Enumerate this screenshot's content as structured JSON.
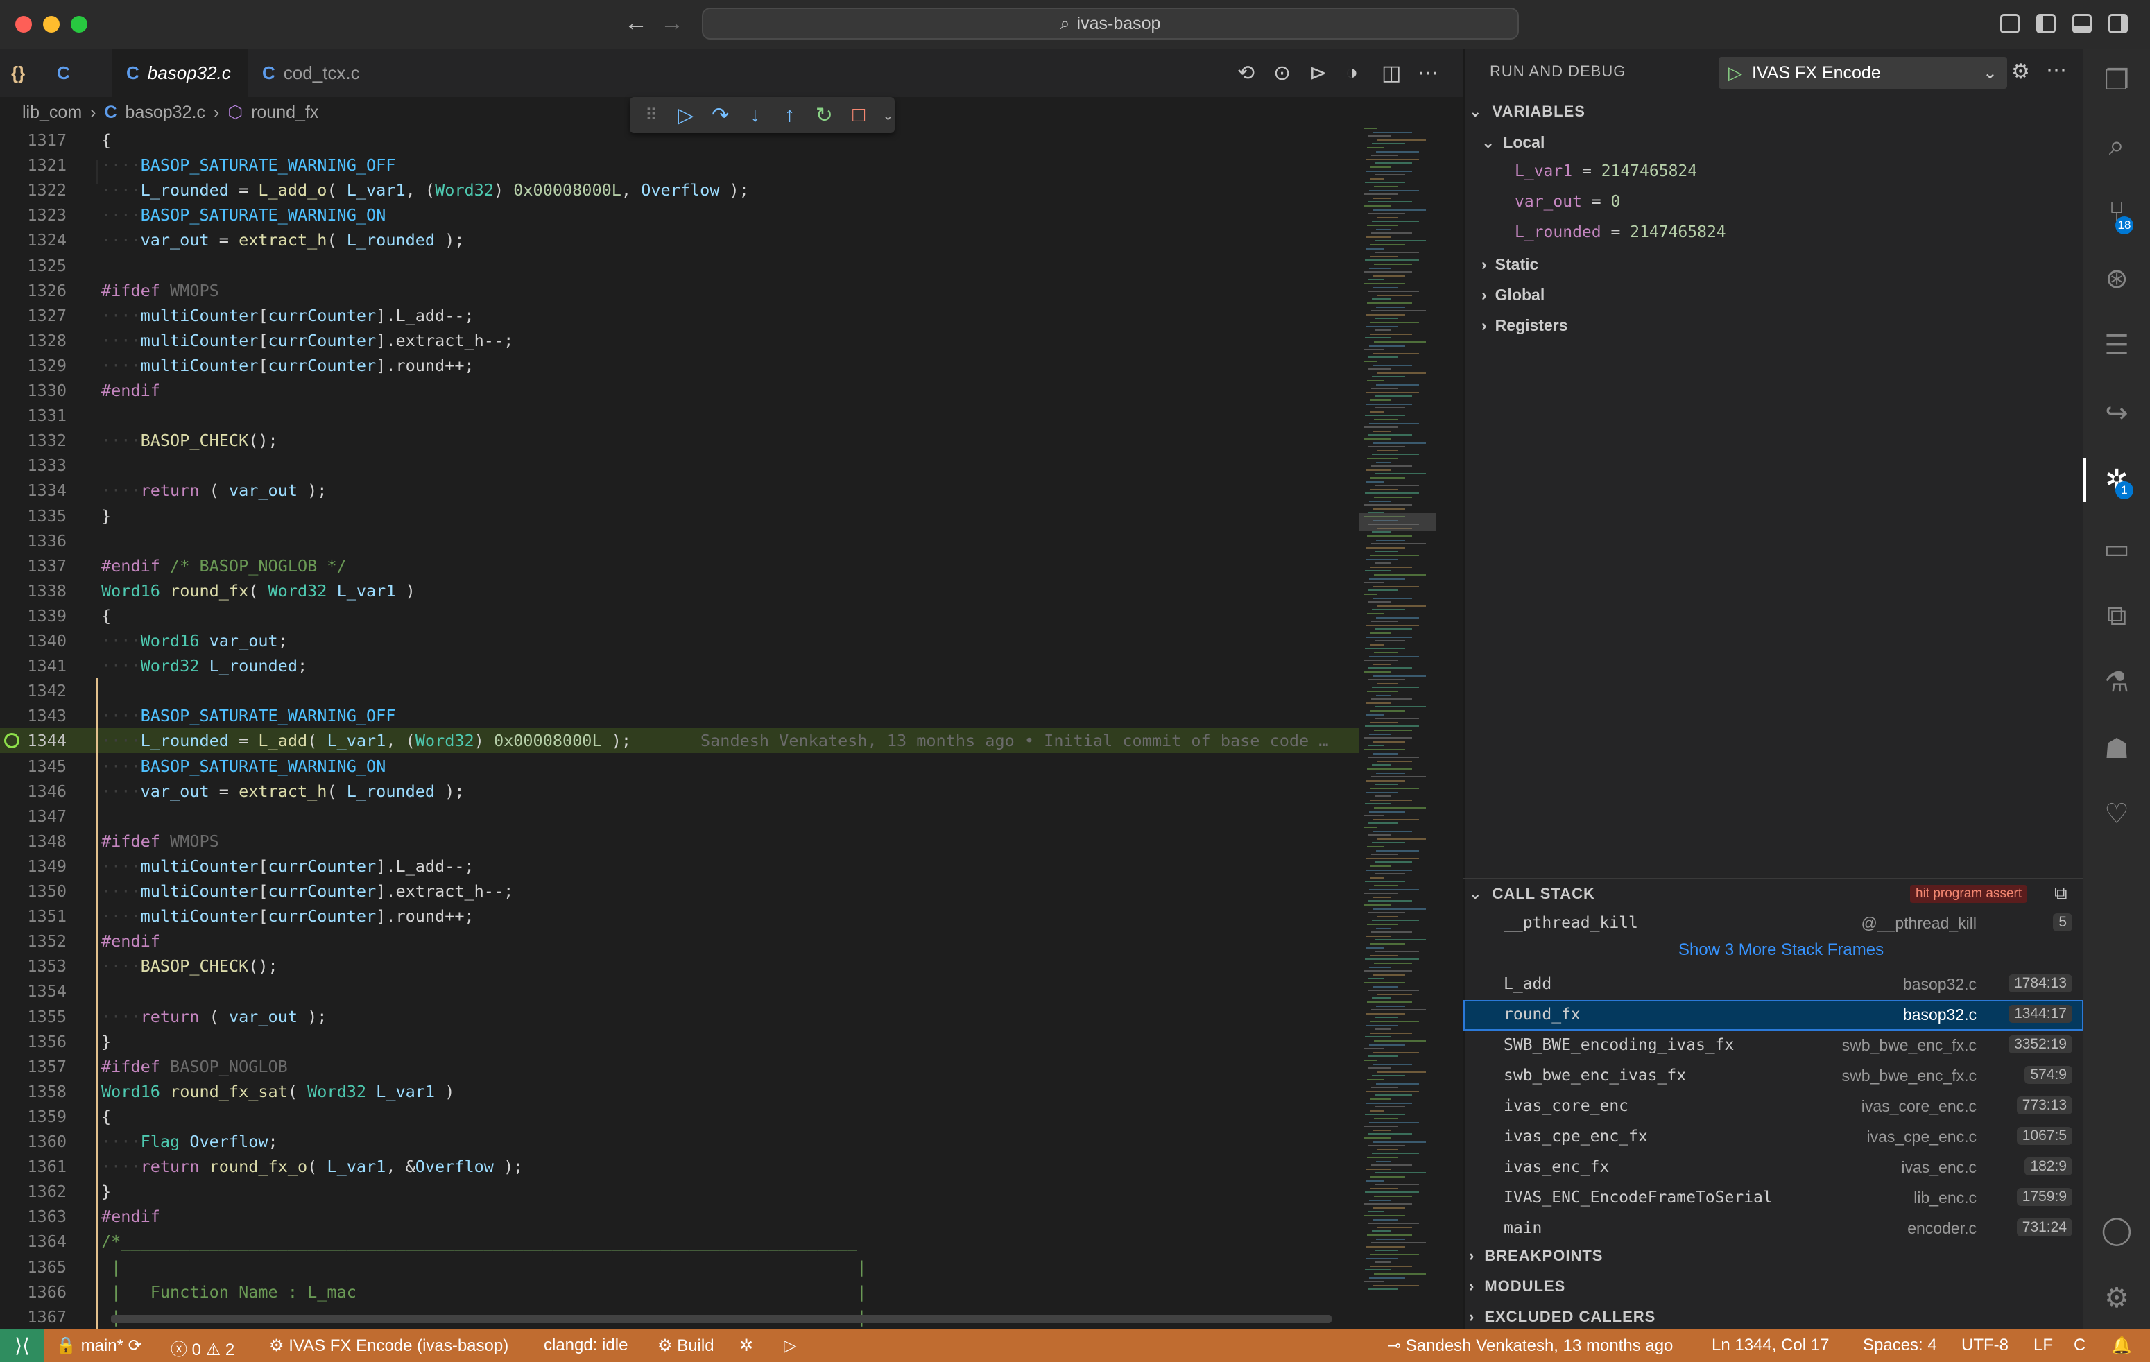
{
  "window": {
    "command_center": "ivas-basop"
  },
  "tabs": [
    {
      "label": "{}"
    },
    {
      "label": "C"
    },
    {
      "label": "basop32.c",
      "icon": "C"
    },
    {
      "label": "cod_tcx.c",
      "icon": "C"
    }
  ],
  "breadcrumb": [
    "lib_com",
    "basop32.c",
    "round_fx"
  ],
  "breadcrumb_icon": "C",
  "editor": {
    "lines": [
      {
        "n": "1317",
        "code": "{"
      },
      {
        "n": "1321",
        "code": "    BASOP_SATURATE_WARNING_OFF"
      },
      {
        "n": "1322",
        "code": "    L_rounded = L_add_o( L_var1, (Word32) 0x00008000L, Overflow );"
      },
      {
        "n": "1323",
        "code": "    BASOP_SATURATE_WARNING_ON"
      },
      {
        "n": "1324",
        "code": "    var_out = extract_h( L_rounded );"
      },
      {
        "n": "1325",
        "code": ""
      },
      {
        "n": "1326",
        "code": "#ifdef WMOPS"
      },
      {
        "n": "1327",
        "code": "    multiCounter[currCounter].L_add--;"
      },
      {
        "n": "1328",
        "code": "    multiCounter[currCounter].extract_h--;"
      },
      {
        "n": "1329",
        "code": "    multiCounter[currCounter].round++;"
      },
      {
        "n": "1330",
        "code": "#endif"
      },
      {
        "n": "1331",
        "code": ""
      },
      {
        "n": "1332",
        "code": "    BASOP_CHECK();"
      },
      {
        "n": "1333",
        "code": ""
      },
      {
        "n": "1334",
        "code": "    return ( var_out );"
      },
      {
        "n": "1335",
        "code": "}"
      },
      {
        "n": "1336",
        "code": ""
      },
      {
        "n": "1337",
        "code": "#endif /* BASOP_NOGLOB */"
      },
      {
        "n": "1338",
        "code": "Word16 round_fx( Word32 L_var1 )"
      },
      {
        "n": "1339",
        "code": "{"
      },
      {
        "n": "1340",
        "code": "    Word16 var_out;"
      },
      {
        "n": "1341",
        "code": "    Word32 L_rounded;"
      },
      {
        "n": "1342",
        "code": ""
      },
      {
        "n": "1343",
        "code": "    BASOP_SATURATE_WARNING_OFF"
      },
      {
        "n": "1344",
        "code": "    L_rounded = L_add( L_var1, (Word32) 0x00008000L );",
        "blame": "Sandesh Venkatesh, 13 months ago • Initial commit of base code …"
      },
      {
        "n": "1345",
        "code": "    BASOP_SATURATE_WARNING_ON"
      },
      {
        "n": "1346",
        "code": "    var_out = extract_h( L_rounded );"
      },
      {
        "n": "1347",
        "code": ""
      },
      {
        "n": "1348",
        "code": "#ifdef WMOPS"
      },
      {
        "n": "1349",
        "code": "    multiCounter[currCounter].L_add--;"
      },
      {
        "n": "1350",
        "code": "    multiCounter[currCounter].extract_h--;"
      },
      {
        "n": "1351",
        "code": "    multiCounter[currCounter].round++;"
      },
      {
        "n": "1352",
        "code": "#endif"
      },
      {
        "n": "1353",
        "code": "    BASOP_CHECK();"
      },
      {
        "n": "1354",
        "code": ""
      },
      {
        "n": "1355",
        "code": "    return ( var_out );"
      },
      {
        "n": "1356",
        "code": "}"
      },
      {
        "n": "1357",
        "code": "#ifdef BASOP_NOGLOB"
      },
      {
        "n": "1358",
        "code": "Word16 round_fx_sat( Word32 L_var1 )"
      },
      {
        "n": "1359",
        "code": "{"
      },
      {
        "n": "1360",
        "code": "    Flag Overflow;"
      },
      {
        "n": "1361",
        "code": "    return round_fx_o( L_var1, &Overflow );"
      },
      {
        "n": "1362",
        "code": "}"
      },
      {
        "n": "1363",
        "code": "#endif"
      },
      {
        "n": "1364",
        "code": "/*___________________________________________________________________________"
      },
      {
        "n": "1365",
        "code": " |                                                                           |"
      },
      {
        "n": "1366",
        "code": " |   Function Name : L_mac                                                   |"
      },
      {
        "n": "1367",
        "code": " |                                                                           |"
      }
    ],
    "current_line": "1344"
  },
  "debug": {
    "title": "RUN AND DEBUG",
    "config": "IVAS FX Encode",
    "variables_title": "VARIABLES",
    "local_label": "Local",
    "locals": [
      {
        "name": "L_var1",
        "value": "2147465824"
      },
      {
        "name": "var_out",
        "value": "0"
      },
      {
        "name": "L_rounded",
        "value": "2147465824"
      }
    ],
    "scopes": [
      "Static",
      "Global",
      "Registers"
    ],
    "call_stack_title": "CALL STACK",
    "call_stack_status": "hit program assert",
    "frames": [
      {
        "fn": "__pthread_kill",
        "file": "@__pthread_kill",
        "pos": "5"
      },
      {
        "fn": "L_add",
        "file": "basop32.c",
        "pos": "1784:13"
      },
      {
        "fn": "round_fx",
        "file": "basop32.c",
        "pos": "1344:17"
      },
      {
        "fn": "SWB_BWE_encoding_ivas_fx",
        "file": "swb_bwe_enc_fx.c",
        "pos": "3352:19"
      },
      {
        "fn": "swb_bwe_enc_ivas_fx",
        "file": "swb_bwe_enc_fx.c",
        "pos": "574:9"
      },
      {
        "fn": "ivas_core_enc",
        "file": "ivas_core_enc.c",
        "pos": "773:13"
      },
      {
        "fn": "ivas_cpe_enc_fx",
        "file": "ivas_cpe_enc.c",
        "pos": "1067:5"
      },
      {
        "fn": "ivas_enc_fx",
        "file": "ivas_enc.c",
        "pos": "182:9"
      },
      {
        "fn": "IVAS_ENC_EncodeFrameToSerial",
        "file": "lib_enc.c",
        "pos": "1759:9"
      },
      {
        "fn": "main",
        "file": "encoder.c",
        "pos": "731:24"
      }
    ],
    "show_more": "Show 3 More Stack Frames",
    "breakpoints_title": "BREAKPOINTS",
    "modules_title": "MODULES",
    "excluded_title": "EXCLUDED CALLERS"
  },
  "activity_badges": {
    "source_control": "18",
    "debug": "1"
  },
  "statusbar": {
    "branch": "main*",
    "errors": "0",
    "warnings": "2",
    "launch": "IVAS FX Encode (ivas-basop)",
    "clangd": "clangd: idle",
    "build": "Build",
    "blame": "Sandesh Venkatesh, 13 months ago",
    "cursor": "Ln 1344, Col 17",
    "spaces": "Spaces: 4",
    "encoding": "UTF-8",
    "eol": "LF",
    "language": "C"
  },
  "colors": {
    "statusbar": "#c06c30",
    "accent": "#0078d4",
    "current_line": "#3e5a1e"
  }
}
